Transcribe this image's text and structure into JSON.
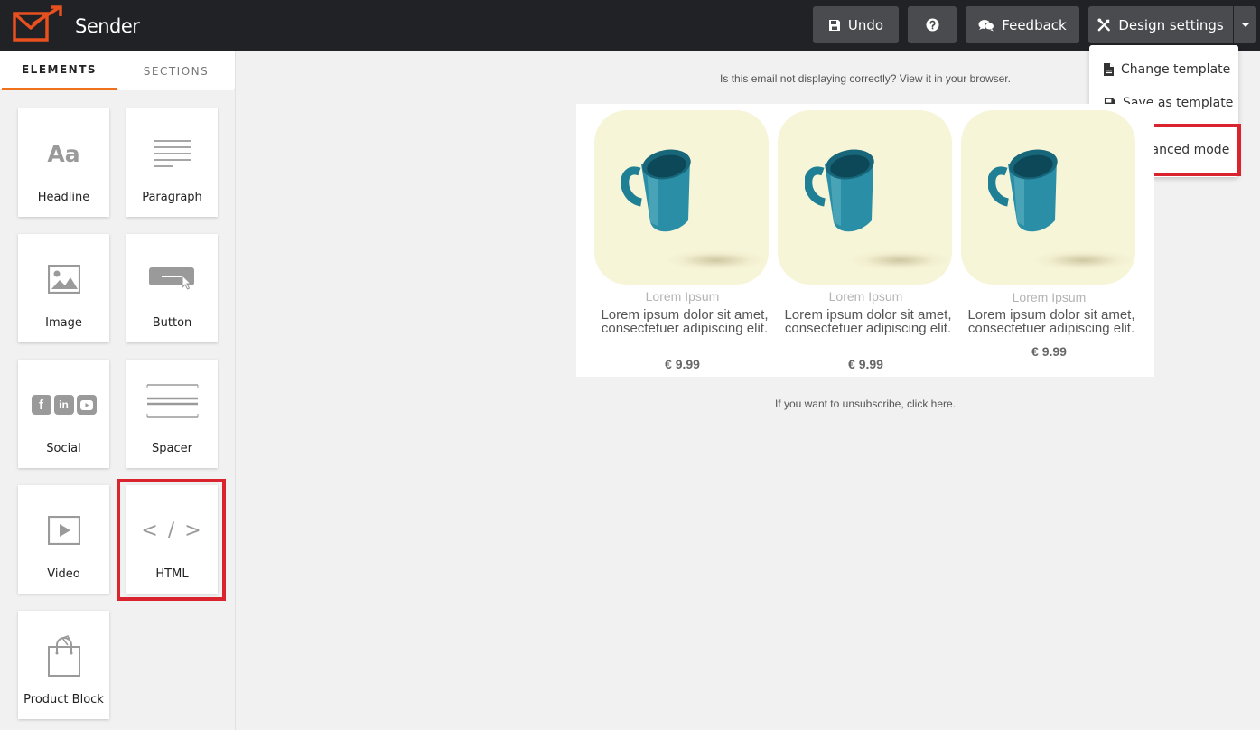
{
  "app": {
    "brand": "Sender"
  },
  "toolbar": {
    "undo_label": "Undo",
    "feedback_label": "Feedback",
    "design_settings_label": "Design settings"
  },
  "design_menu": {
    "items": [
      {
        "label": "Change template",
        "icon": "file-icon"
      },
      {
        "label": "Save as template",
        "icon": "floppy-icon"
      },
      {
        "label": "Advanced mode",
        "icon": "gears-icon",
        "highlighted": true
      }
    ]
  },
  "sidebar": {
    "tabs": [
      {
        "label": "ELEMENTS",
        "active": true
      },
      {
        "label": "SECTIONS",
        "active": false
      }
    ],
    "elements": [
      {
        "label": "Headline",
        "icon": "text-aa-icon",
        "icon_text": "Aa"
      },
      {
        "label": "Paragraph",
        "icon": "paragraph-lines-icon"
      },
      {
        "label": "Image",
        "icon": "image-icon"
      },
      {
        "label": "Button",
        "icon": "button-icon"
      },
      {
        "label": "Social",
        "icon": "social-icons",
        "icon_text": [
          "f",
          "in"
        ]
      },
      {
        "label": "Spacer",
        "icon": "spacer-icon"
      },
      {
        "label": "Video",
        "icon": "video-play-icon"
      },
      {
        "label": "HTML",
        "icon": "code-icon",
        "icon_text": "< / >",
        "highlighted": true
      },
      {
        "label": "Product Block",
        "icon": "shopping-bag-icon"
      }
    ]
  },
  "email": {
    "browser_note": "Is this email not displaying correctly? View it in your browser.",
    "products": [
      {
        "category": "Lorem Ipsum",
        "description": "Lorem ipsum dolor sit amet, consectetuer adipiscing elit.",
        "price": "€ 9.99"
      },
      {
        "category": "Lorem Ipsum",
        "description": "Lorem ipsum dolor sit amet, consectetuer adipiscing elit.",
        "price": "€ 9.99"
      },
      {
        "category": "Lorem Ipsum",
        "description": "Lorem ipsum dolor sit amet, consectetuer adipiscing elit.",
        "price": "€ 9.99"
      }
    ],
    "unsubscribe_note": "If you want to unsubscribe, click here."
  },
  "colors": {
    "topbar": "#212226",
    "button_bg": "#4a4b4f",
    "accent_orange": "#f0711b",
    "highlight_red": "#d9232e",
    "product_bg": "#f7f5d8",
    "mug_teal": "#1f7f95"
  }
}
